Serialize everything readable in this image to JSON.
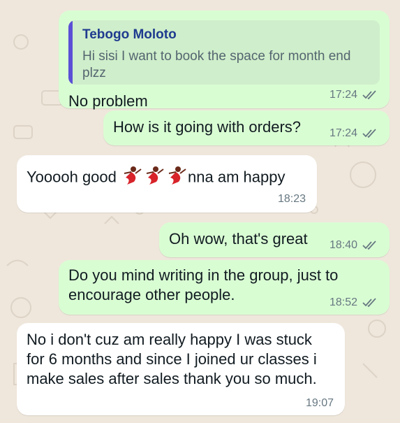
{
  "messages": [
    {
      "direction": "outgoing",
      "reply_to": {
        "author": "Tebogo Moloto",
        "text": "Hi sisi I want to book the space for month end plzz"
      },
      "text": "No problem",
      "time": "17:24",
      "status": "read"
    },
    {
      "direction": "outgoing",
      "text": "How is it going with orders?",
      "time": "17:24",
      "status": "read"
    },
    {
      "direction": "incoming",
      "text_before": "Yooooh good",
      "emoji_name": "dancer-emoji",
      "emoji_count": 3,
      "text_after": "nna am happy",
      "time": "18:23"
    },
    {
      "direction": "outgoing",
      "text": "Oh wow, that's great",
      "time": "18:40",
      "status": "read"
    },
    {
      "direction": "outgoing",
      "text": "Do you mind writing in the group, just to encourage other people.",
      "time": "18:52",
      "status": "read"
    },
    {
      "direction": "incoming",
      "text": "No i don't cuz am really happy I was stuck for 6 months and since I joined ur classes i make sales after sales thank you so much.",
      "time": "19:07"
    }
  ],
  "colors": {
    "outgoing_bubble": "#d9fdd3",
    "incoming_bubble": "#ffffff",
    "wallpaper": "#efe7dc",
    "quote_bar": "#5b4fd6",
    "quote_author": "#1f3b8f",
    "read_ticks": "#667781"
  }
}
